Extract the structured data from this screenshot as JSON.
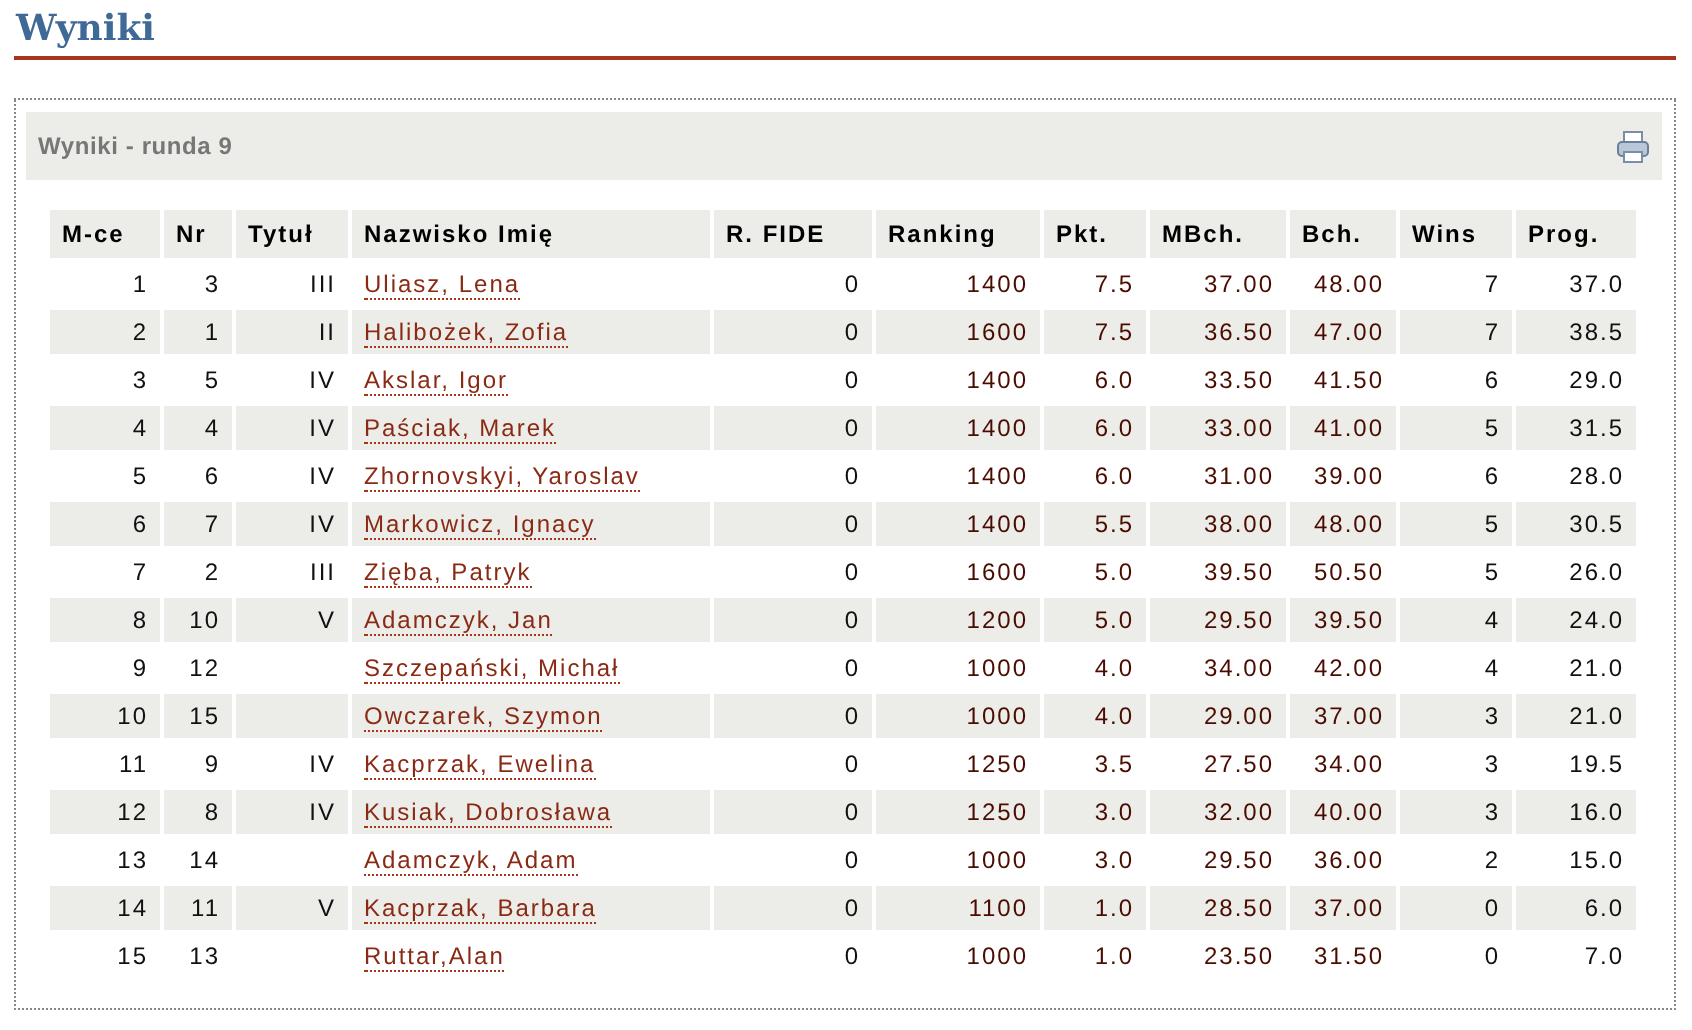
{
  "page_title": "Wyniki",
  "panel": {
    "title": "Wyniki - runda 9"
  },
  "table": {
    "columns": [
      "M-ce",
      "Nr",
      "Tytuł",
      "Nazwisko Imię",
      "R. FIDE",
      "Ranking",
      "Pkt.",
      "MBch.",
      "Bch.",
      "Wins",
      "Prog."
    ],
    "rows": [
      [
        "1",
        "3",
        "III",
        "Uliasz, Lena",
        "0",
        "1400",
        "7.5",
        "37.00",
        "48.00",
        "7",
        "37.0"
      ],
      [
        "2",
        "1",
        "II",
        "Halibożek, Zofia",
        "0",
        "1600",
        "7.5",
        "36.50",
        "47.00",
        "7",
        "38.5"
      ],
      [
        "3",
        "5",
        "IV",
        "Akslar, Igor",
        "0",
        "1400",
        "6.0",
        "33.50",
        "41.50",
        "6",
        "29.0"
      ],
      [
        "4",
        "4",
        "IV",
        "Paściak, Marek",
        "0",
        "1400",
        "6.0",
        "33.00",
        "41.00",
        "5",
        "31.5"
      ],
      [
        "5",
        "6",
        "IV",
        "Zhornovskyi, Yaroslav",
        "0",
        "1400",
        "6.0",
        "31.00",
        "39.00",
        "6",
        "28.0"
      ],
      [
        "6",
        "7",
        "IV",
        "Markowicz, Ignacy",
        "0",
        "1400",
        "5.5",
        "38.00",
        "48.00",
        "5",
        "30.5"
      ],
      [
        "7",
        "2",
        "III",
        "Zięba, Patryk",
        "0",
        "1600",
        "5.0",
        "39.50",
        "50.50",
        "5",
        "26.0"
      ],
      [
        "8",
        "10",
        "V",
        "Adamczyk, Jan",
        "0",
        "1200",
        "5.0",
        "29.50",
        "39.50",
        "4",
        "24.0"
      ],
      [
        "9",
        "12",
        "",
        "Szczepański, Michał",
        "0",
        "1000",
        "4.0",
        "34.00",
        "42.00",
        "4",
        "21.0"
      ],
      [
        "10",
        "15",
        "",
        "Owczarek, Szymon",
        "0",
        "1000",
        "4.0",
        "29.00",
        "37.00",
        "3",
        "21.0"
      ],
      [
        "11",
        "9",
        "IV",
        "Kacprzak, Ewelina",
        "0",
        "1250",
        "3.5",
        "27.50",
        "34.00",
        "3",
        "19.5"
      ],
      [
        "12",
        "8",
        "IV",
        "Kusiak, Dobrosława",
        "0",
        "1250",
        "3.0",
        "32.00",
        "40.00",
        "3",
        "16.0"
      ],
      [
        "13",
        "14",
        "",
        "Adamczyk, Adam",
        "0",
        "1000",
        "3.0",
        "29.50",
        "36.00",
        "2",
        "15.0"
      ],
      [
        "14",
        "11",
        "V",
        "Kacprzak, Barbara",
        "0",
        "1100",
        "1.0",
        "28.50",
        "37.00",
        "0",
        "6.0"
      ],
      [
        "15",
        "13",
        "",
        "Ruttar,Alan",
        "0",
        "1000",
        "1.0",
        "23.50",
        "31.50",
        "0",
        "7.0"
      ]
    ]
  }
}
